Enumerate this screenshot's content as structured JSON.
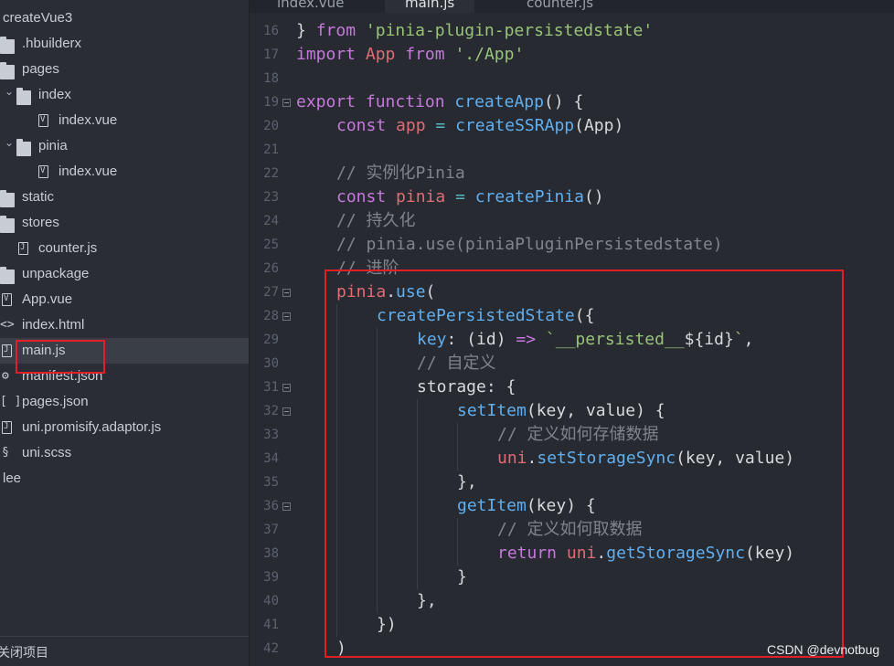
{
  "sidebar": {
    "items": [
      {
        "label": "createVue3",
        "kind": "project",
        "depth": 0
      },
      {
        "label": ".hbuilderx",
        "kind": "folder",
        "depth": 0
      },
      {
        "label": "pages",
        "kind": "folder",
        "depth": 0
      },
      {
        "label": "index",
        "kind": "folder-open",
        "depth": 1
      },
      {
        "label": "index.vue",
        "kind": "vue-file",
        "depth": 2
      },
      {
        "label": "pinia",
        "kind": "folder-open",
        "depth": 1
      },
      {
        "label": "index.vue",
        "kind": "vue-file",
        "depth": 2
      },
      {
        "label": "static",
        "kind": "folder",
        "depth": 0
      },
      {
        "label": "stores",
        "kind": "folder",
        "depth": 0
      },
      {
        "label": "counter.js",
        "kind": "js-file",
        "depth": 1
      },
      {
        "label": "unpackage",
        "kind": "folder",
        "depth": 0
      },
      {
        "label": "App.vue",
        "kind": "vue-file",
        "depth": 0
      },
      {
        "label": "index.html",
        "kind": "html-file",
        "depth": 0
      },
      {
        "label": "main.js",
        "kind": "js-file",
        "depth": 0
      },
      {
        "label": "manifest.json",
        "kind": "json-settings-file",
        "depth": 0
      },
      {
        "label": "pages.json",
        "kind": "json-file",
        "depth": 0
      },
      {
        "label": "uni.promisify.adaptor.js",
        "kind": "js-file",
        "depth": 0
      },
      {
        "label": "uni.scss",
        "kind": "scss-file",
        "depth": 0
      },
      {
        "label": "lee",
        "kind": "project",
        "depth": 0
      }
    ],
    "footer_label": "关闭项目"
  },
  "tabs": [
    {
      "label": "index.vue",
      "active": false
    },
    {
      "label": "main.js",
      "active": true
    },
    {
      "label": "counter.js",
      "active": false
    }
  ],
  "editor": {
    "lines": [
      {
        "n": "16",
        "fold": false,
        "indent": 0,
        "tokens": [
          [
            "pl",
            "} "
          ],
          [
            "kw",
            "from"
          ],
          [
            "pl",
            " "
          ],
          [
            "str",
            "'pinia-plugin-persistedstate'"
          ]
        ]
      },
      {
        "n": "17",
        "fold": false,
        "indent": 0,
        "tokens": [
          [
            "kw",
            "import"
          ],
          [
            "pl",
            " "
          ],
          [
            "var",
            "App"
          ],
          [
            "pl",
            " "
          ],
          [
            "kw",
            "from"
          ],
          [
            "pl",
            " "
          ],
          [
            "str",
            "'./App'"
          ]
        ]
      },
      {
        "n": "18",
        "fold": false,
        "indent": 0,
        "tokens": []
      },
      {
        "n": "19",
        "fold": true,
        "indent": 0,
        "tokens": [
          [
            "kw",
            "export"
          ],
          [
            "pl",
            " "
          ],
          [
            "kw",
            "function"
          ],
          [
            "pl",
            " "
          ],
          [
            "fn",
            "createApp"
          ],
          [
            "pl",
            "() {"
          ]
        ]
      },
      {
        "n": "20",
        "fold": false,
        "indent": 1,
        "tokens": [
          [
            "kw",
            "const"
          ],
          [
            "pl",
            " "
          ],
          [
            "var",
            "app"
          ],
          [
            "pl",
            " "
          ],
          [
            "op",
            "="
          ],
          [
            "pl",
            " "
          ],
          [
            "fn",
            "createSSRApp"
          ],
          [
            "pl",
            "(App)"
          ]
        ]
      },
      {
        "n": "21",
        "fold": false,
        "indent": 0,
        "tokens": []
      },
      {
        "n": "22",
        "fold": false,
        "indent": 1,
        "tokens": [
          [
            "cm",
            "// 实例化Pinia"
          ]
        ]
      },
      {
        "n": "23",
        "fold": false,
        "indent": 1,
        "tokens": [
          [
            "kw",
            "const"
          ],
          [
            "pl",
            " "
          ],
          [
            "var",
            "pinia"
          ],
          [
            "pl",
            " "
          ],
          [
            "op",
            "="
          ],
          [
            "pl",
            " "
          ],
          [
            "fn",
            "createPinia"
          ],
          [
            "pl",
            "()"
          ]
        ]
      },
      {
        "n": "24",
        "fold": false,
        "indent": 1,
        "tokens": [
          [
            "cm",
            "// 持久化"
          ]
        ]
      },
      {
        "n": "25",
        "fold": false,
        "indent": 1,
        "tokens": [
          [
            "cm",
            "// pinia.use(piniaPluginPersistedstate)"
          ]
        ]
      },
      {
        "n": "26",
        "fold": false,
        "indent": 1,
        "tokens": [
          [
            "cm",
            "// 进阶"
          ]
        ]
      },
      {
        "n": "27",
        "fold": true,
        "indent": 1,
        "tokens": [
          [
            "var",
            "pinia"
          ],
          [
            "pl",
            "."
          ],
          [
            "fn",
            "use"
          ],
          [
            "pl",
            "("
          ]
        ]
      },
      {
        "n": "28",
        "fold": true,
        "indent": 2,
        "tokens": [
          [
            "fn",
            "createPersistedState"
          ],
          [
            "pl",
            "({"
          ]
        ]
      },
      {
        "n": "29",
        "fold": false,
        "indent": 3,
        "tokens": [
          [
            "prop",
            "key"
          ],
          [
            "pl",
            ": (id) "
          ],
          [
            "kw",
            "=>"
          ],
          [
            "pl",
            " "
          ],
          [
            "str",
            "`__persisted__"
          ],
          [
            "pl",
            "${id}"
          ],
          [
            "str",
            "`"
          ],
          [
            "pl",
            ","
          ]
        ]
      },
      {
        "n": "30",
        "fold": false,
        "indent": 3,
        "tokens": [
          [
            "cm",
            "// 自定义"
          ]
        ]
      },
      {
        "n": "31",
        "fold": true,
        "indent": 3,
        "tokens": [
          [
            "pl",
            "storage: {"
          ]
        ]
      },
      {
        "n": "32",
        "fold": true,
        "indent": 4,
        "tokens": [
          [
            "fn",
            "setItem"
          ],
          [
            "pl",
            "(key, value) {"
          ]
        ]
      },
      {
        "n": "33",
        "fold": false,
        "indent": 5,
        "tokens": [
          [
            "cm",
            "// 定义如何存储数据"
          ]
        ]
      },
      {
        "n": "34",
        "fold": false,
        "indent": 5,
        "tokens": [
          [
            "var",
            "uni"
          ],
          [
            "pl",
            "."
          ],
          [
            "fn",
            "setStorageSync"
          ],
          [
            "pl",
            "(key, value)"
          ]
        ]
      },
      {
        "n": "35",
        "fold": false,
        "indent": 4,
        "tokens": [
          [
            "pl",
            "},"
          ]
        ]
      },
      {
        "n": "36",
        "fold": true,
        "indent": 4,
        "tokens": [
          [
            "fn",
            "getItem"
          ],
          [
            "pl",
            "(key) {"
          ]
        ]
      },
      {
        "n": "37",
        "fold": false,
        "indent": 5,
        "tokens": [
          [
            "cm",
            "// 定义如何取数据"
          ]
        ]
      },
      {
        "n": "38",
        "fold": false,
        "indent": 5,
        "tokens": [
          [
            "kw",
            "return"
          ],
          [
            "pl",
            " "
          ],
          [
            "var",
            "uni"
          ],
          [
            "pl",
            "."
          ],
          [
            "fn",
            "getStorageSync"
          ],
          [
            "pl",
            "(key)"
          ]
        ]
      },
      {
        "n": "39",
        "fold": false,
        "indent": 4,
        "tokens": [
          [
            "pl",
            "}"
          ]
        ]
      },
      {
        "n": "40",
        "fold": false,
        "indent": 3,
        "tokens": [
          [
            "pl",
            "},"
          ]
        ]
      },
      {
        "n": "41",
        "fold": false,
        "indent": 2,
        "tokens": [
          [
            "pl",
            "})"
          ]
        ]
      },
      {
        "n": "42",
        "fold": false,
        "indent": 1,
        "tokens": [
          [
            "pl",
            ")"
          ]
        ]
      }
    ]
  },
  "watermark": "CSDN @devnotbug",
  "colors": {
    "highlight": "#e31e24",
    "background": "#272a31",
    "sidebar": "#2a2d35"
  }
}
